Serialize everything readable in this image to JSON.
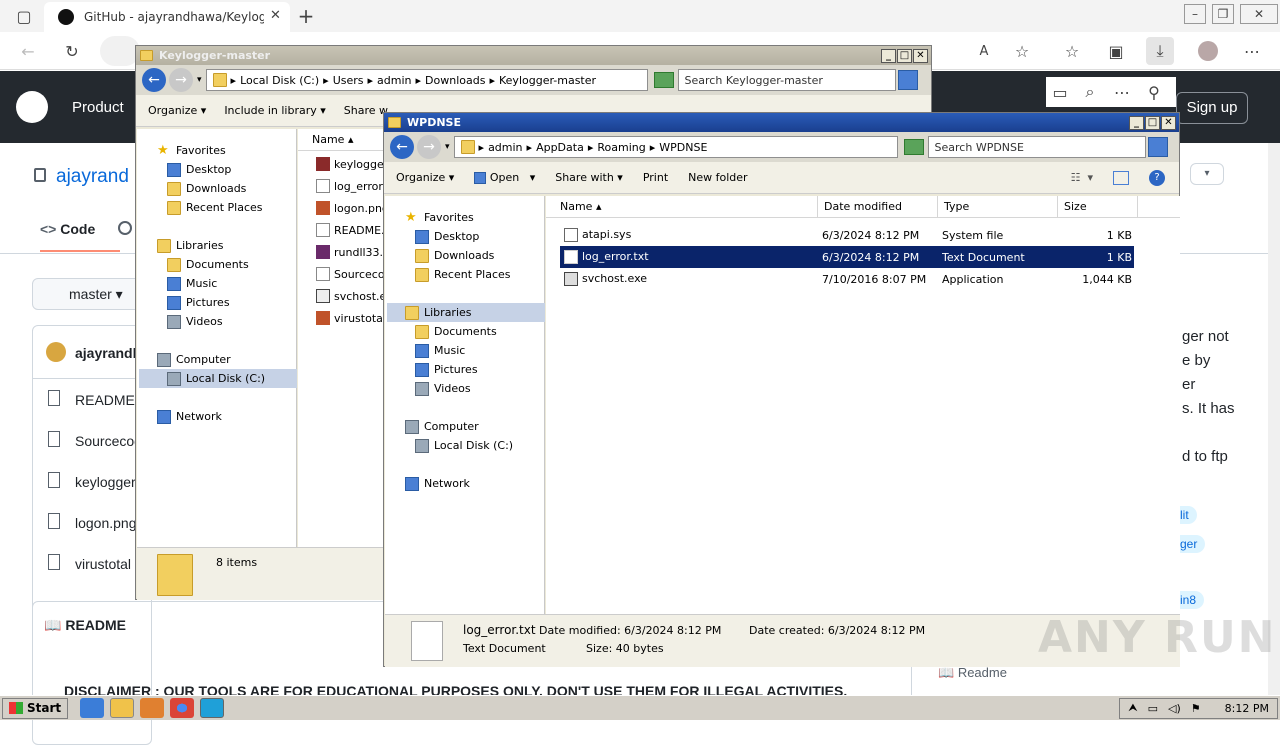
{
  "browser": {
    "tab_title": "GitHub - ajayrandhawa/Keylogger",
    "new_tab": "+"
  },
  "github": {
    "nav_product": "Product",
    "sign_up": "Sign up",
    "repo_owner": "ajayrand",
    "tab_code": "Code",
    "branch": "master",
    "commit_author": "ajayrandh",
    "files": [
      "README.",
      "Sourcecod",
      "keylogger",
      "logon.png",
      "virustotal"
    ],
    "readme_header": "README",
    "disclaimer": "DISCLAIMER : OUR TOOLS ARE FOR EDUCATIONAL PURPOSES ONLY. DON'T USE THEM FOR ILLEGAL ACTIVITIES.",
    "about_lines": [
      "ger not",
      "e by",
      "er",
      "s. It has",
      "",
      "d to ftp"
    ],
    "topics": [
      "lit",
      "ger",
      "in8"
    ],
    "readme_link": "Readme"
  },
  "win1": {
    "title": "Keylogger-master",
    "breadcrumb": [
      "Local Disk (C:)",
      "Users",
      "admin",
      "Downloads",
      "Keylogger-master"
    ],
    "search_placeholder": "Search Keylogger-master",
    "cmd": {
      "organize": "Organize",
      "include": "Include in library",
      "share": "Share w"
    },
    "nav": {
      "favorites": "Favorites",
      "fav_items": [
        "Desktop",
        "Downloads",
        "Recent Places"
      ],
      "libraries": "Libraries",
      "lib_items": [
        "Documents",
        "Music",
        "Pictures",
        "Videos"
      ],
      "computer": "Computer",
      "local_disk": "Local Disk (C:)",
      "network": "Network"
    },
    "col_name": "Name",
    "files": [
      "keylogger",
      "log_error.",
      "logon.png",
      "README.m",
      "rundll33.e",
      "Sourcecoc",
      "svchost.ex",
      "virustotal."
    ],
    "status": "8 items"
  },
  "win2": {
    "title": "WPDNSE",
    "breadcrumb": [
      "admin",
      "AppData",
      "Roaming",
      "WPDNSE"
    ],
    "search_placeholder": "Search WPDNSE",
    "cmd": {
      "organize": "Organize",
      "open": "Open",
      "share": "Share with",
      "print": "Print",
      "new_folder": "New folder"
    },
    "nav": {
      "favorites": "Favorites",
      "fav_items": [
        "Desktop",
        "Downloads",
        "Recent Places"
      ],
      "libraries": "Libraries",
      "lib_items": [
        "Documents",
        "Music",
        "Pictures",
        "Videos"
      ],
      "computer": "Computer",
      "local_disk": "Local Disk (C:)",
      "network": "Network"
    },
    "columns": {
      "name": "Name",
      "date": "Date modified",
      "type": "Type",
      "size": "Size"
    },
    "files": [
      {
        "name": "atapi.sys",
        "date": "6/3/2024 8:12 PM",
        "type": "System file",
        "size": "1 KB"
      },
      {
        "name": "log_error.txt",
        "date": "6/3/2024 8:12 PM",
        "type": "Text Document",
        "size": "1 KB"
      },
      {
        "name": "svchost.exe",
        "date": "7/10/2016 8:07 PM",
        "type": "Application",
        "size": "1,044 KB"
      }
    ],
    "details": {
      "name": "log_error.txt",
      "modified": "Date modified: 6/3/2024 8:12 PM",
      "created": "Date created: 6/3/2024 8:12 PM",
      "type": "Text Document",
      "size": "Size: 40 bytes"
    }
  },
  "taskbar": {
    "start": "Start",
    "time": "8:12 PM"
  },
  "watermark": "ANY RUN"
}
